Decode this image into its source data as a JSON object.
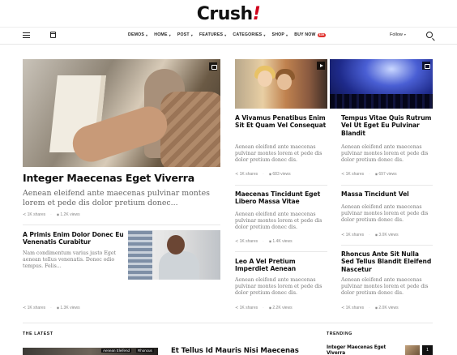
{
  "brand": {
    "name": "Crush",
    "mark": "!"
  },
  "nav": {
    "items": [
      {
        "label": "DEMOS",
        "caret": true
      },
      {
        "label": "HOME",
        "caret": true
      },
      {
        "label": "POST",
        "caret": true
      },
      {
        "label": "FEATURES",
        "caret": true
      },
      {
        "label": "CATEGORIES",
        "caret": true
      },
      {
        "label": "SHOP",
        "caret": true
      },
      {
        "label": "BUY NOW",
        "caret": false,
        "badge": "$39"
      }
    ],
    "follow_label": "Follow"
  },
  "featured": {
    "title": "Integer Maecenas Eget Viverra",
    "excerpt": "Aenean eleifend ante maecenas pulvinar montes lorem et pede dis dolor pretium donec...",
    "shares": "1K shares",
    "views": "1.2K views"
  },
  "side_post": {
    "title": "A Primis Enim Dolor Donec Eu Venenatis Curabitur",
    "excerpt": "Nam condimentum varius justo Eget aenean tellus venenatis. Donec odio tempus. Felis...",
    "shares": "1K shares",
    "views": "1.3K views"
  },
  "grid": [
    {
      "title": "A Vivamus Penatibus Enim Sit Et Quam Vel Consequat",
      "excerpt": "Aenean eleifend ante maecenas pulvinar montes lorem et pede dis dolor pretium donec dis.",
      "shares": "1K shares",
      "views": "683 views"
    },
    {
      "title": "Tempus Vitae Quis Rutrum Vel Ut Eget Eu Pulvinar Blandit",
      "excerpt": "Aenean eleifend ante maecenas pulvinar montes lorem et pede dis dolor pretium donec dis.",
      "shares": "1K shares",
      "views": "697 views"
    },
    {
      "title": "Maecenas Tincidunt Eget Libero Massa Vitae",
      "excerpt": "Aenean eleifend ante maecenas pulvinar montes lorem et pede dis dolor pretium donec dis.",
      "shares": "1K shares",
      "views": "1.4K views"
    },
    {
      "title": "Massa Tincidunt Vel",
      "excerpt": "Aenean eleifend ante maecenas pulvinar montes lorem et pede dis dolor pretium donec dis.",
      "shares": "1K shares",
      "views": "3.0K views"
    },
    {
      "title": "Leo A Vel Pretium Imperdiet Aenean",
      "excerpt": "Aenean eleifend ante maecenas pulvinar montes lorem et pede dis dolor pretium donec dis.",
      "shares": "1K shares",
      "views": "2.2K views"
    },
    {
      "title": "Rhoncus Ante Sit Nulla Sed Tellus Blandit Eleifend Nascetur",
      "excerpt": "Aenean eleifend ante maecenas pulvinar montes lorem et pede dis dolor pretium donec dis.",
      "shares": "1K shares",
      "views": "2.0K views"
    }
  ],
  "latest": {
    "label": "THE LATEST",
    "tags": [
      "Aenean Eleifend",
      "Rhoncus"
    ],
    "headline": "Et Tellus Id Mauris Nisi Maecenas"
  },
  "trending": {
    "label": "TRENDING",
    "headline": "Integer Maecenas Eget Viverra",
    "rank": "1"
  },
  "colors": {
    "accent": "#d0021b",
    "badge": "#e0302d"
  }
}
